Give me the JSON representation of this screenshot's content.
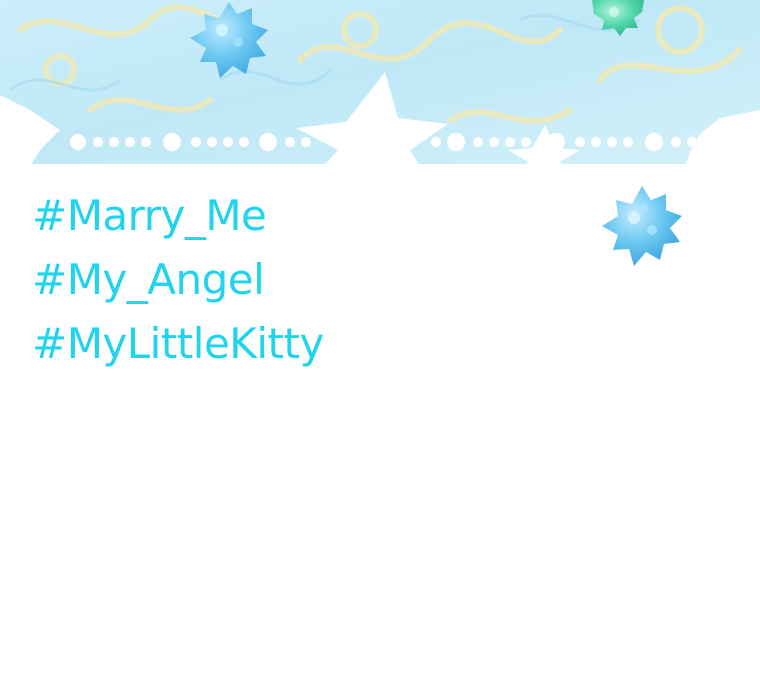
{
  "hashtags": [
    "#Marry_Me",
    "#My_Angel",
    "#MyLittleKitty"
  ],
  "decorations": {
    "banner_icon": "watercolor-banner",
    "star_icon": "star-silhouette",
    "pearl_icon": "pearl-string",
    "candy_icon": "konpeito-candy"
  },
  "colors": {
    "hashtag_text": "#22d3ee",
    "banner_watercolor": "#c6ecf8",
    "banner_yellow": "#f4ecb0",
    "candy_blue": "#5fc4f0",
    "candy_green": "#4fd6a8"
  }
}
